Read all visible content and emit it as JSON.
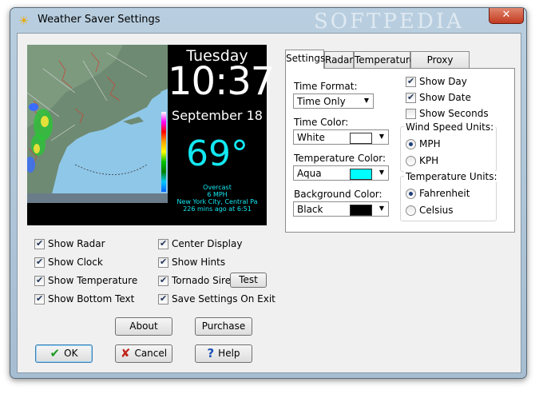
{
  "window": {
    "title": "Weather Saver Settings",
    "watermark": "SOFTPEDIA"
  },
  "preview": {
    "day": "Tuesday",
    "time": "10:37",
    "date": "September 18",
    "temperature": "69°",
    "condition": "Overcast",
    "wind": "6 MPH",
    "station": "New York City, Central Pa",
    "updated": "226 mins ago at 6:51"
  },
  "options": {
    "show_radar": "Show Radar",
    "show_clock": "Show Clock",
    "show_temperature": "Show Temperature",
    "show_bottom_text": "Show Bottom Text",
    "center_display": "Center Display",
    "show_hints": "Show Hints",
    "tornado_siren": "Tornado Siren",
    "test": "Test",
    "save_settings": "Save Settings On Exit"
  },
  "buttons": {
    "about": "About",
    "purchase": "Purchase",
    "ok": "OK",
    "cancel": "Cancel",
    "help": "Help"
  },
  "tabs": [
    "Settings",
    "Radar",
    "Temperature",
    "Proxy Server"
  ],
  "settings": {
    "time_format_label": "Time Format:",
    "time_format_value": "Time Only",
    "time_color_label": "Time Color:",
    "time_color_value": "White",
    "time_color_hex": "#ffffff",
    "temp_color_label": "Temperature Color:",
    "temp_color_value": "Aqua",
    "temp_color_hex": "#00ffff",
    "bg_color_label": "Background Color:",
    "bg_color_value": "Black",
    "bg_color_hex": "#000000",
    "show_day": "Show Day",
    "show_date": "Show Date",
    "show_seconds": "Show Seconds",
    "wind_units_title": "Wind Speed Units:",
    "wind_mph": "MPH",
    "wind_kph": "KPH",
    "temp_units_title": "Temperature Units:",
    "temp_f": "Fahrenheit",
    "temp_c": "Celsius"
  }
}
